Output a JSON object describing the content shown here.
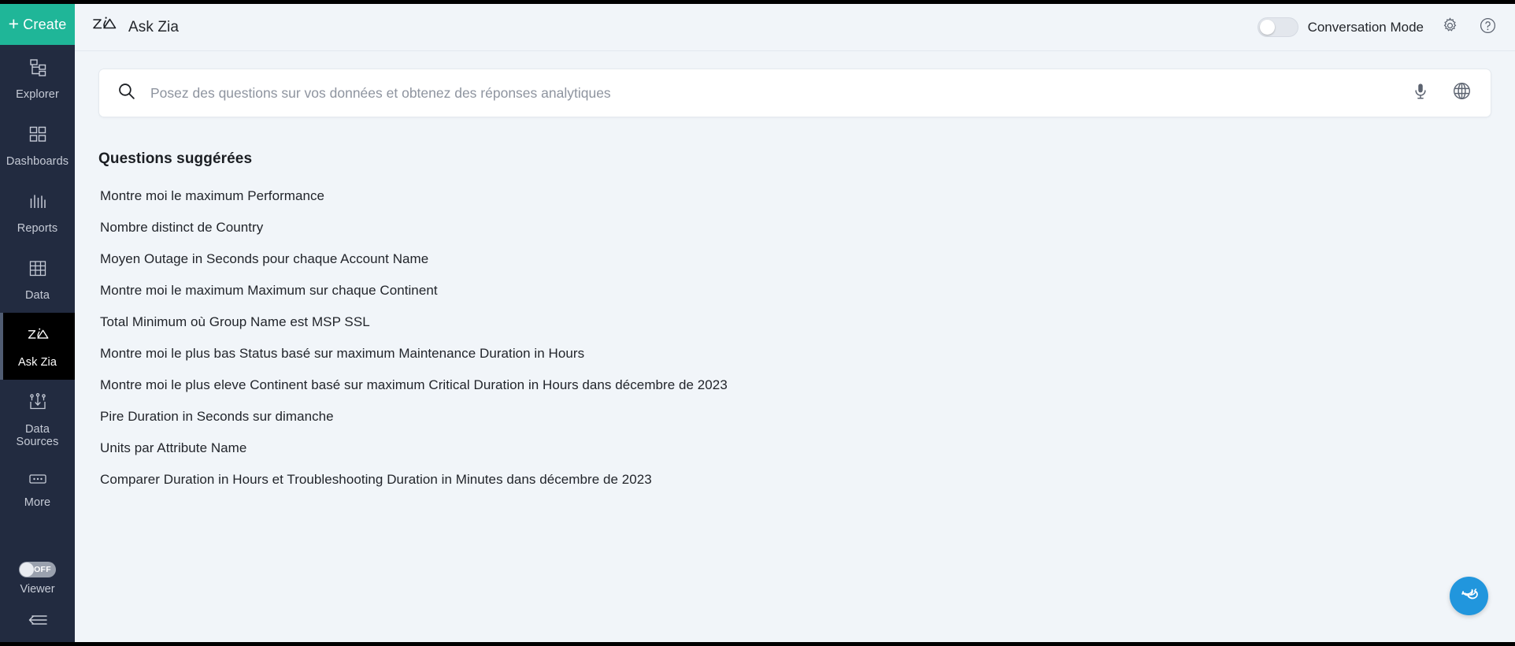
{
  "sidebar": {
    "create_label": "Create",
    "items": [
      {
        "id": "explorer",
        "label": "Explorer",
        "icon": "hierarchy-icon",
        "active": false
      },
      {
        "id": "dashboards",
        "label": "Dashboards",
        "icon": "grid-icon",
        "active": false
      },
      {
        "id": "reports",
        "label": "Reports",
        "icon": "bar-chart-icon",
        "active": false
      },
      {
        "id": "data",
        "label": "Data",
        "icon": "table-icon",
        "active": false
      },
      {
        "id": "ask-zia",
        "label": "Ask Zia",
        "icon": "zia-logo-icon",
        "active": true
      },
      {
        "id": "data-sources",
        "label": "Data\nSources",
        "icon": "import-icon",
        "active": false
      },
      {
        "id": "more",
        "label": "More",
        "icon": "ellipsis-icon",
        "active": false
      }
    ],
    "viewer": {
      "label": "Viewer",
      "toggle_state": "OFF"
    },
    "collapse_icon": "collapse-left-icon"
  },
  "topbar": {
    "logo_icon": "zia-logo-icon",
    "title": "Ask Zia",
    "conversation_mode": {
      "label": "Conversation Mode",
      "enabled": false
    },
    "settings_icon": "gear-icon",
    "help_icon": "help-circle-icon"
  },
  "search": {
    "icon": "search-icon",
    "value": "",
    "placeholder": "Posez des questions sur vos données et obtenez des réponses analytiques",
    "mic_icon": "microphone-icon",
    "globe_icon": "globe-icon"
  },
  "suggested": {
    "title": "Questions suggérées",
    "questions": [
      "Montre moi le maximum Performance",
      "Nombre distinct de Country",
      "Moyen Outage in Seconds pour chaque Account Name",
      "Montre moi le maximum Maximum sur chaque Continent",
      "Total Minimum où Group Name est MSP SSL",
      "Montre moi le plus bas Status basé sur maximum Maintenance Duration in Hours",
      "Montre moi le plus eleve Continent basé sur maximum Critical Duration in Hours dans décembre de 2023",
      "Pire Duration in Seconds sur dimanche",
      "Units par Attribute Name",
      "Comparer Duration in Hours et Troubleshooting Duration in Minutes dans décembre de 2023"
    ]
  },
  "fab": {
    "icon": "chat-bubbles-icon"
  },
  "colors": {
    "sidebar_bg": "#222b40",
    "create_bg": "#1fb698",
    "active_item_bg": "#000000",
    "content_bg": "#f1f5f9",
    "fab_bg": "#2196dd"
  }
}
